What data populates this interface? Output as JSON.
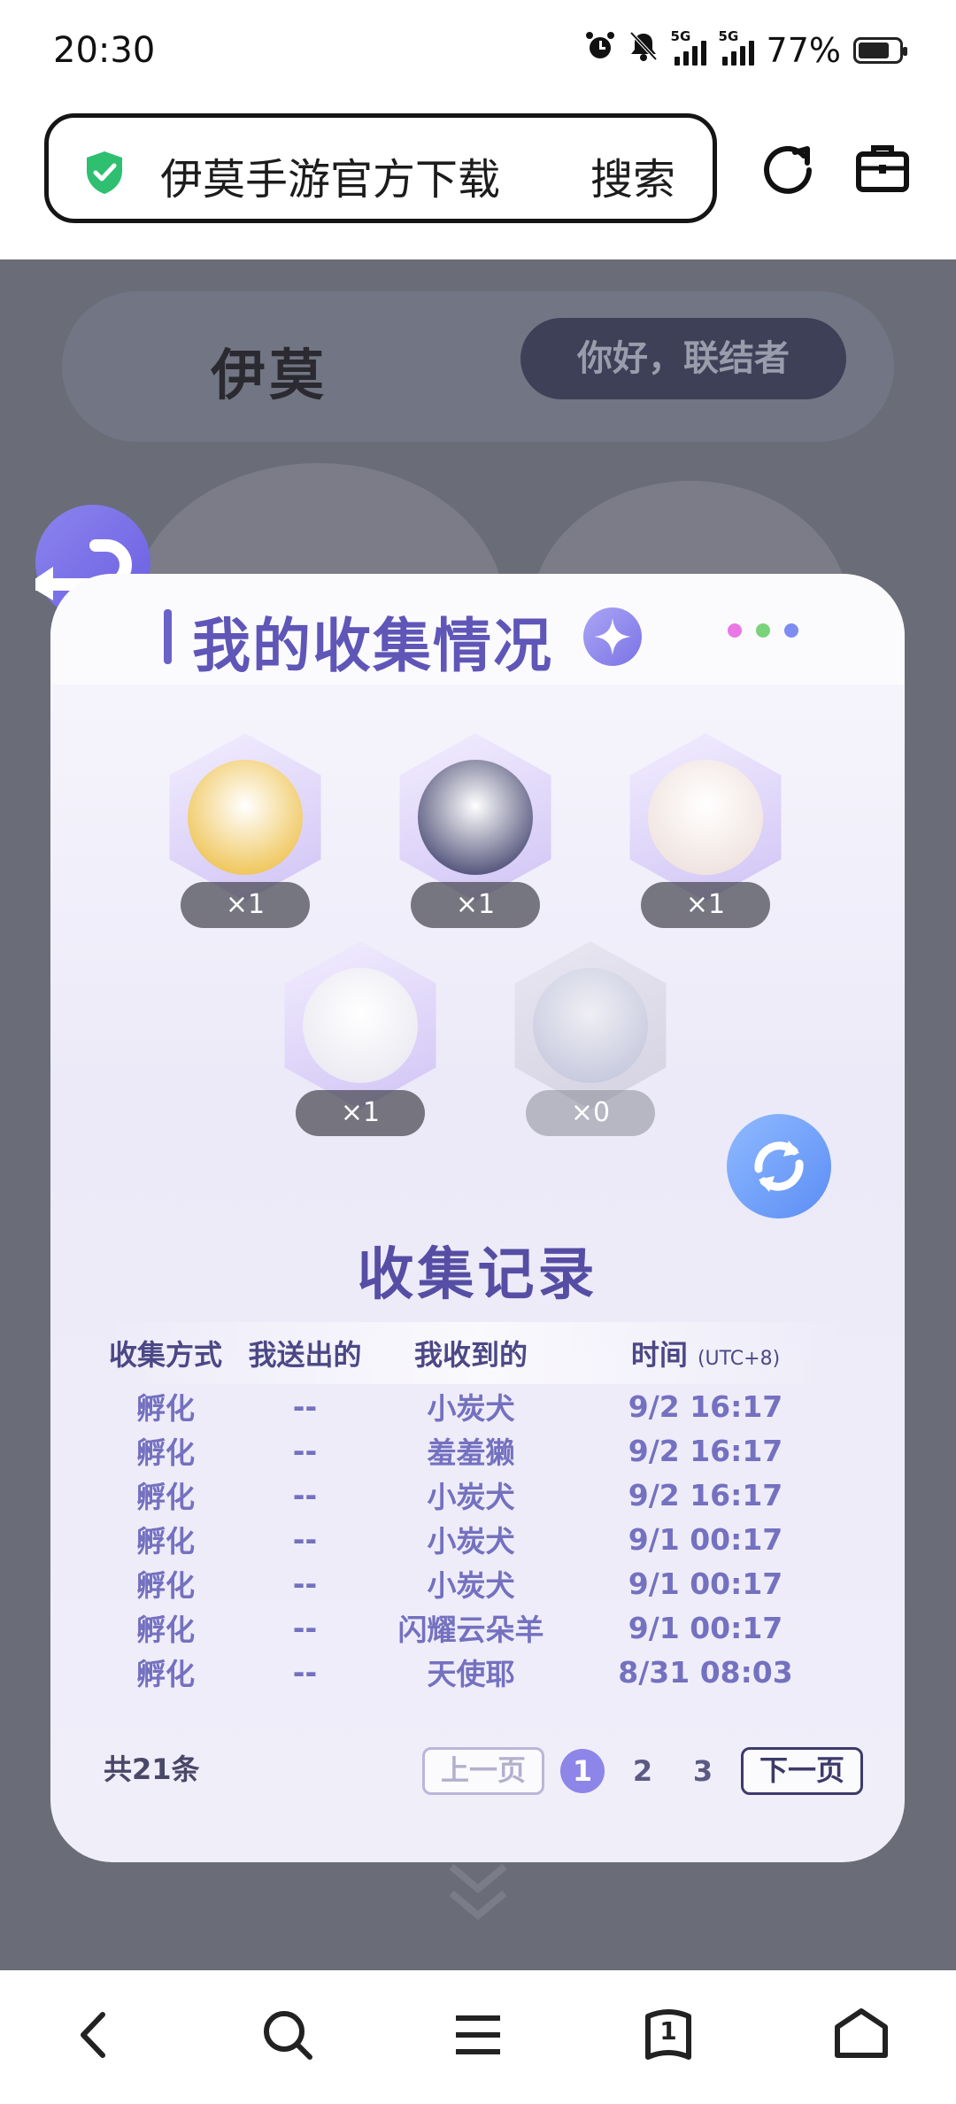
{
  "status": {
    "time": "20:30",
    "network1": "5G",
    "network2": "5G",
    "battery_text": "77%",
    "battery_level": 0.77
  },
  "browser": {
    "query": "伊莫手游官方下载",
    "search_label": "搜索"
  },
  "web": {
    "logo_text": "伊莫",
    "greeting_button": "你好，联结者"
  },
  "card": {
    "title": "我的收集情况",
    "pets": [
      {
        "count": "×1",
        "color": "#f0c860"
      },
      {
        "count": "×1",
        "color": "#5a5a80"
      },
      {
        "count": "×1",
        "color": "#f0e4e0"
      },
      {
        "count": "×1",
        "color": "#ecebf2"
      },
      {
        "count": "×0",
        "color": "#b8bed8"
      }
    ],
    "records_title": "收集记录",
    "headers": {
      "method": "收集方式",
      "sent": "我送出的",
      "received": "我收到的",
      "time": "时间",
      "tz": "(UTC+8)"
    },
    "records": [
      {
        "method": "孵化",
        "sent": "--",
        "received": "小炭犬",
        "time": "9/2 16:17"
      },
      {
        "method": "孵化",
        "sent": "--",
        "received": "羞羞獭",
        "time": "9/2 16:17"
      },
      {
        "method": "孵化",
        "sent": "--",
        "received": "小炭犬",
        "time": "9/2 16:17"
      },
      {
        "method": "孵化",
        "sent": "--",
        "received": "小炭犬",
        "time": "9/1 00:17"
      },
      {
        "method": "孵化",
        "sent": "--",
        "received": "小炭犬",
        "time": "9/1 00:17"
      },
      {
        "method": "孵化",
        "sent": "--",
        "received": "闪耀云朵羊",
        "time": "9/1 00:17"
      },
      {
        "method": "孵化",
        "sent": "--",
        "received": "天使耶",
        "time": "8/31 08:03"
      }
    ],
    "total": "共21条",
    "pager": {
      "prev": "上一页",
      "pages": [
        "1",
        "2",
        "3"
      ],
      "next": "下一页",
      "current": "1"
    }
  },
  "nav": {
    "tab_count": "1"
  },
  "colors": {
    "accent": "#5f56b8",
    "dot1": "#e977e6",
    "dot2": "#7ad27a",
    "dot3": "#7d8cf0"
  }
}
